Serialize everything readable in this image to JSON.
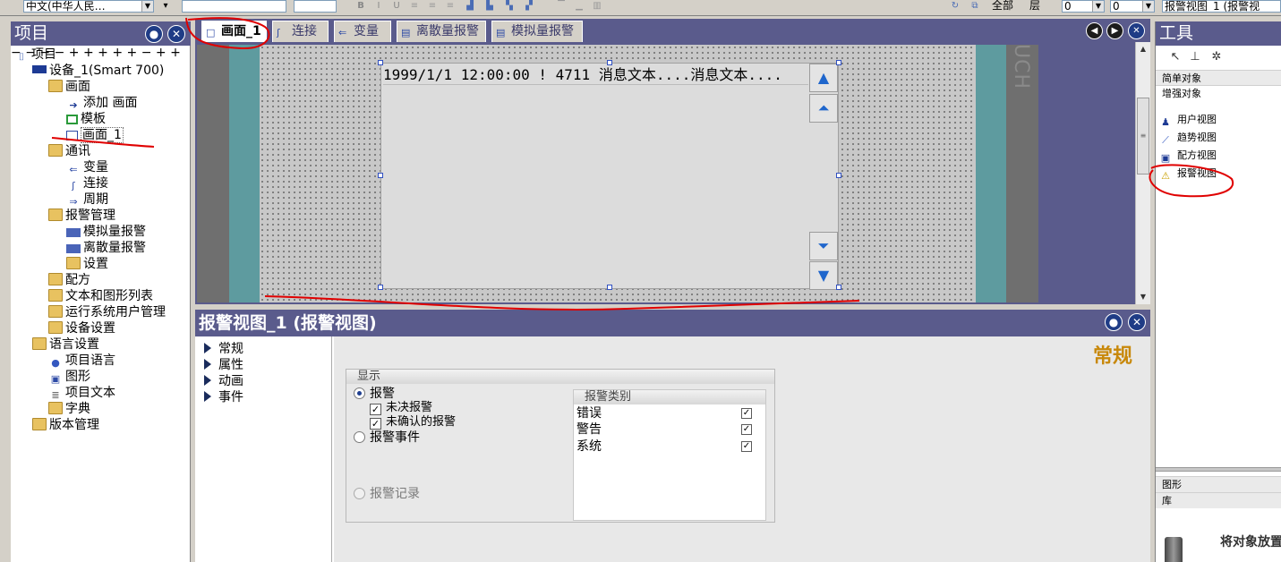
{
  "toolbar": {
    "language_combo": "中文(中华人民…",
    "bold": "B",
    "layer_text": "全部",
    "layer_label": "层",
    "num1": "0",
    "num2": "0",
    "object_combo": "报警视图_1 (报警视"
  },
  "project_panel": {
    "title": "项目",
    "tree": [
      {
        "label": "项目"
      },
      {
        "label": "设备_1(Smart 700)"
      },
      {
        "label": "画面"
      },
      {
        "label": "添加 画面"
      },
      {
        "label": "模板"
      },
      {
        "label": "画面_1"
      },
      {
        "label": "通讯"
      },
      {
        "label": "变量"
      },
      {
        "label": "连接"
      },
      {
        "label": "周期"
      },
      {
        "label": "报警管理"
      },
      {
        "label": "模拟量报警"
      },
      {
        "label": "离散量报警"
      },
      {
        "label": "设置"
      },
      {
        "label": "配方"
      },
      {
        "label": "文本和图形列表"
      },
      {
        "label": "运行系统用户管理"
      },
      {
        "label": "设备设置"
      },
      {
        "label": "语言设置"
      },
      {
        "label": "项目语言"
      },
      {
        "label": "图形"
      },
      {
        "label": "项目文本"
      },
      {
        "label": "字典"
      },
      {
        "label": "版本管理"
      }
    ]
  },
  "editor": {
    "tabs": [
      {
        "label": "画面_1"
      },
      {
        "label": "连接"
      },
      {
        "label": "变量"
      },
      {
        "label": "离散量报警"
      },
      {
        "label": "模拟量报警"
      }
    ],
    "device_brand": "UCH",
    "alarm_row": "1999/1/1 12:00:00 ! 4711 消息文本....消息文本...."
  },
  "properties": {
    "title": "报警视图_1 (报警视图)",
    "nav": [
      {
        "label": "常规"
      },
      {
        "label": "属性"
      },
      {
        "label": "动画"
      },
      {
        "label": "事件"
      }
    ],
    "section_title": "常规",
    "display_group_title": "显示",
    "radio_alarms": "报警",
    "check_pending": "未决报警",
    "check_unack": "未确认的报警",
    "radio_events": "报警事件",
    "radio_log": "报警记录",
    "alarm_class_header": "报警类别",
    "alarm_classes": [
      {
        "label": "错误",
        "checked": true
      },
      {
        "label": "警告",
        "checked": true
      },
      {
        "label": "系统",
        "checked": true
      }
    ]
  },
  "tools_panel": {
    "title": "工具",
    "cat_simple": "简单对象",
    "cat_enhanced": "增强对象",
    "items": [
      {
        "label": "用户视图"
      },
      {
        "label": "趋势视图"
      },
      {
        "label": "配方视图"
      },
      {
        "label": "报警视图"
      }
    ],
    "cat_graphics": "图形",
    "cat_library": "库",
    "drop_hint": "将对象放置"
  }
}
